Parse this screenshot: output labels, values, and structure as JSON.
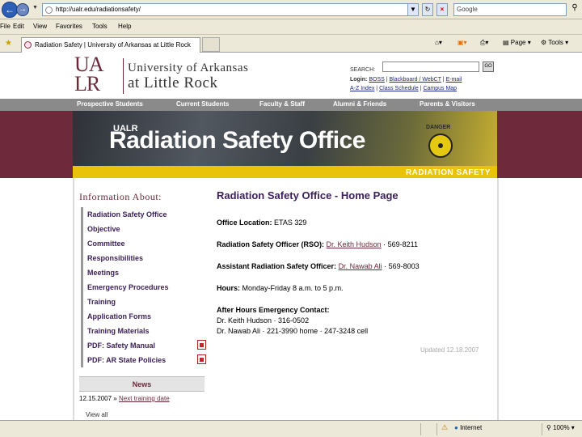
{
  "browser": {
    "url": "http://ualr.edu/radiationsafety/",
    "search_placeholder": "Google",
    "menu": [
      "File",
      "Edit",
      "View",
      "Favorites",
      "Tools",
      "Help"
    ],
    "tab_title": "Radiation Safety | University of Arkansas at Little Rock",
    "toolbar": {
      "page": "Page",
      "tools": "Tools"
    },
    "status": {
      "zone": "Internet",
      "zoom": "100%"
    }
  },
  "header": {
    "logo_mark_1": "UA",
    "logo_mark_2": "LR",
    "logo_line1": "University of Arkansas",
    "logo_line2": "at Little Rock",
    "search_label": "SEARCH:",
    "search_go": "GO",
    "login_label": "Login:",
    "login_links": [
      "BOSS",
      "Blackboard / WebCT",
      "E-mail"
    ],
    "quick_links": [
      "A-Z Index",
      "Class Schedule",
      "Campus Map"
    ]
  },
  "nav": [
    "Prospective Students",
    "Current Students",
    "Faculty & Staff",
    "Alumni & Friends",
    "Parents & Visitors"
  ],
  "banner": {
    "ualr": "UALR",
    "title": "Radiation Safety Office",
    "subtitle": "RADIATION SAFETY",
    "danger": "DANGER"
  },
  "sidebar": {
    "title": "Information About:",
    "items": [
      {
        "label": "Radiation Safety Office",
        "pdf": false
      },
      {
        "label": "Objective",
        "pdf": false
      },
      {
        "label": "Committee",
        "pdf": false
      },
      {
        "label": "Responsibilities",
        "pdf": false
      },
      {
        "label": "Meetings",
        "pdf": false
      },
      {
        "label": "Emergency Procedures",
        "pdf": false
      },
      {
        "label": "Training",
        "pdf": false
      },
      {
        "label": "Application Forms",
        "pdf": false
      },
      {
        "label": "Training Materials",
        "pdf": false
      },
      {
        "label": "PDF: Safety Manual",
        "pdf": true
      },
      {
        "label": "PDF: AR State Policies",
        "pdf": true
      }
    ],
    "news": {
      "heading": "News",
      "date": "12.15.2007",
      "sep": "»",
      "link": "Next training date",
      "view_all": "View all"
    }
  },
  "main": {
    "title": "Radiation Safety Office - Home Page",
    "office_location_label": "Office Location:",
    "office_location_value": "ETAS 329",
    "rso_label": "Radiation Safety Officer (RSO):",
    "rso_name": "Dr. Keith Hudson",
    "rso_phone": "· 569-8211",
    "arso_label": "Assistant Radiation Safety Officer:",
    "arso_name": "Dr. Nawab Ali",
    "arso_phone": "· 569-8003",
    "hours_label": "Hours:",
    "hours_value": "Monday-Friday 8 a.m. to 5 p.m.",
    "after_hours_label": "After Hours Emergency Contact:",
    "after_hours_line1": "Dr. Keith Hudson · 316-0502",
    "after_hours_line2": "Dr. Nawab Ali · 221-3990 home · 247-3248 cell",
    "updated": "Updated 12.18.2007"
  }
}
